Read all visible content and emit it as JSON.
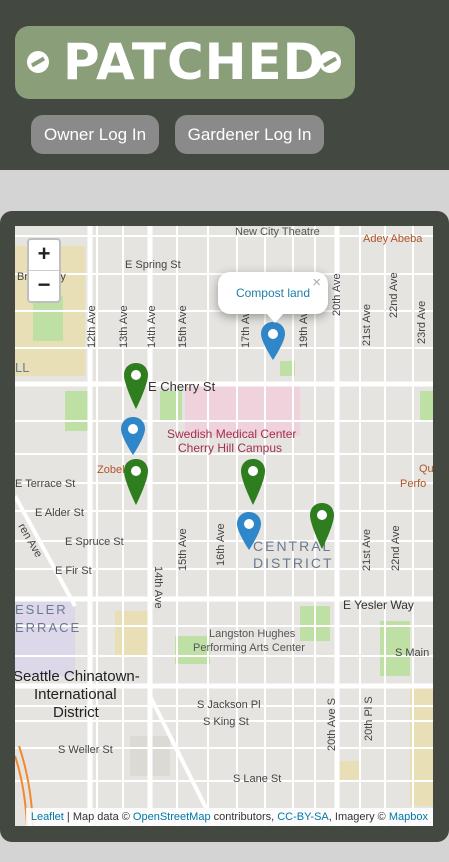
{
  "header": {
    "logo_text": "PATCHED",
    "buttons": {
      "owner_login": "Owner Log In",
      "gardener_login": "Gardener Log In"
    }
  },
  "map": {
    "zoom_in": "+",
    "zoom_out": "−",
    "popup": {
      "text": "Compost land",
      "close": "×"
    },
    "labels": {
      "new_city_theatre": "New City Theatre",
      "adey_abeba": "Adey Abeba",
      "broadway": "Broadway",
      "e_spring_st": "E Spring St",
      "ave_12th": "12th Ave",
      "ave_13th": "13th Ave",
      "ave_14th": "14th Ave",
      "ave_15th": "15th Ave",
      "ave_17th": "17th Ave",
      "ave_19th": "19th Ave",
      "ave_20th": "20th Ave",
      "ave_21st": "21st Ave",
      "ave_22nd": "22nd Ave",
      "ave_23rd": "23rd Ave",
      "e_cherry_st": "E Cherry St",
      "swedish_1": "Swedish Medical Center",
      "swedish_2": "Cherry Hill Campus",
      "zobel": "Zobel",
      "e_terrace_st": "E Terrace St",
      "e_alder_st": "E Alder St",
      "e_spruce_st": "E Spruce St",
      "e_fir_st": "E Fir St",
      "ren_ave": "ren Ave",
      "ave_14th_b": "14th Ave",
      "ave_15th_b": "15th Ave",
      "ave_16th": "16th Ave",
      "ave_21st_b": "21st Ave",
      "ave_22nd_b": "22nd Ave",
      "central": "CENTRAL",
      "district": "DISTRICT",
      "yesler_1": "ESLER",
      "yesler_2": "ERRACE",
      "e_yesler_way": "E Yesler Way",
      "langston_1": "Langston Hughes",
      "langston_2": "Performing Arts Center",
      "s_main": "S Main",
      "chinatown_1": "Seattle Chinatown-",
      "chinatown_2": "International",
      "chinatown_3": "District",
      "s_jackson_pl": "S Jackson Pl",
      "s_king_st": "S King St",
      "ave_20th_s": "20th Ave S",
      "pl_20th_s": "20th Pl S",
      "s_weller_st": "S Weller St",
      "s_lane_st": "S Lane St",
      "qu": "Qu",
      "perfo": "Perfo",
      "ll": "LL"
    },
    "attribution": {
      "leaflet": "Leaflet",
      "sep": " | Map data © ",
      "osm": "OpenStreetMap",
      "contributors": " contributors, ",
      "license": "CC-BY-SA",
      "imagery": ", Imagery © ",
      "mapbox": "Mapbox"
    },
    "pins": [
      {
        "color": "#2e7d1e",
        "kind": "green"
      },
      {
        "color": "#2f86c8",
        "kind": "blue"
      },
      {
        "color": "#2e7d1e",
        "kind": "green"
      },
      {
        "color": "#2e7d1e",
        "kind": "green"
      },
      {
        "color": "#2f86c8",
        "kind": "blue"
      },
      {
        "color": "#2e7d1e",
        "kind": "green"
      },
      {
        "color": "#2f86c8",
        "kind": "blue"
      }
    ]
  },
  "colors": {
    "header_bg": "#434940",
    "logo_bg": "#8a9e7a",
    "button_bg": "#8a8a8a",
    "page_bg": "#d4d4d4"
  }
}
